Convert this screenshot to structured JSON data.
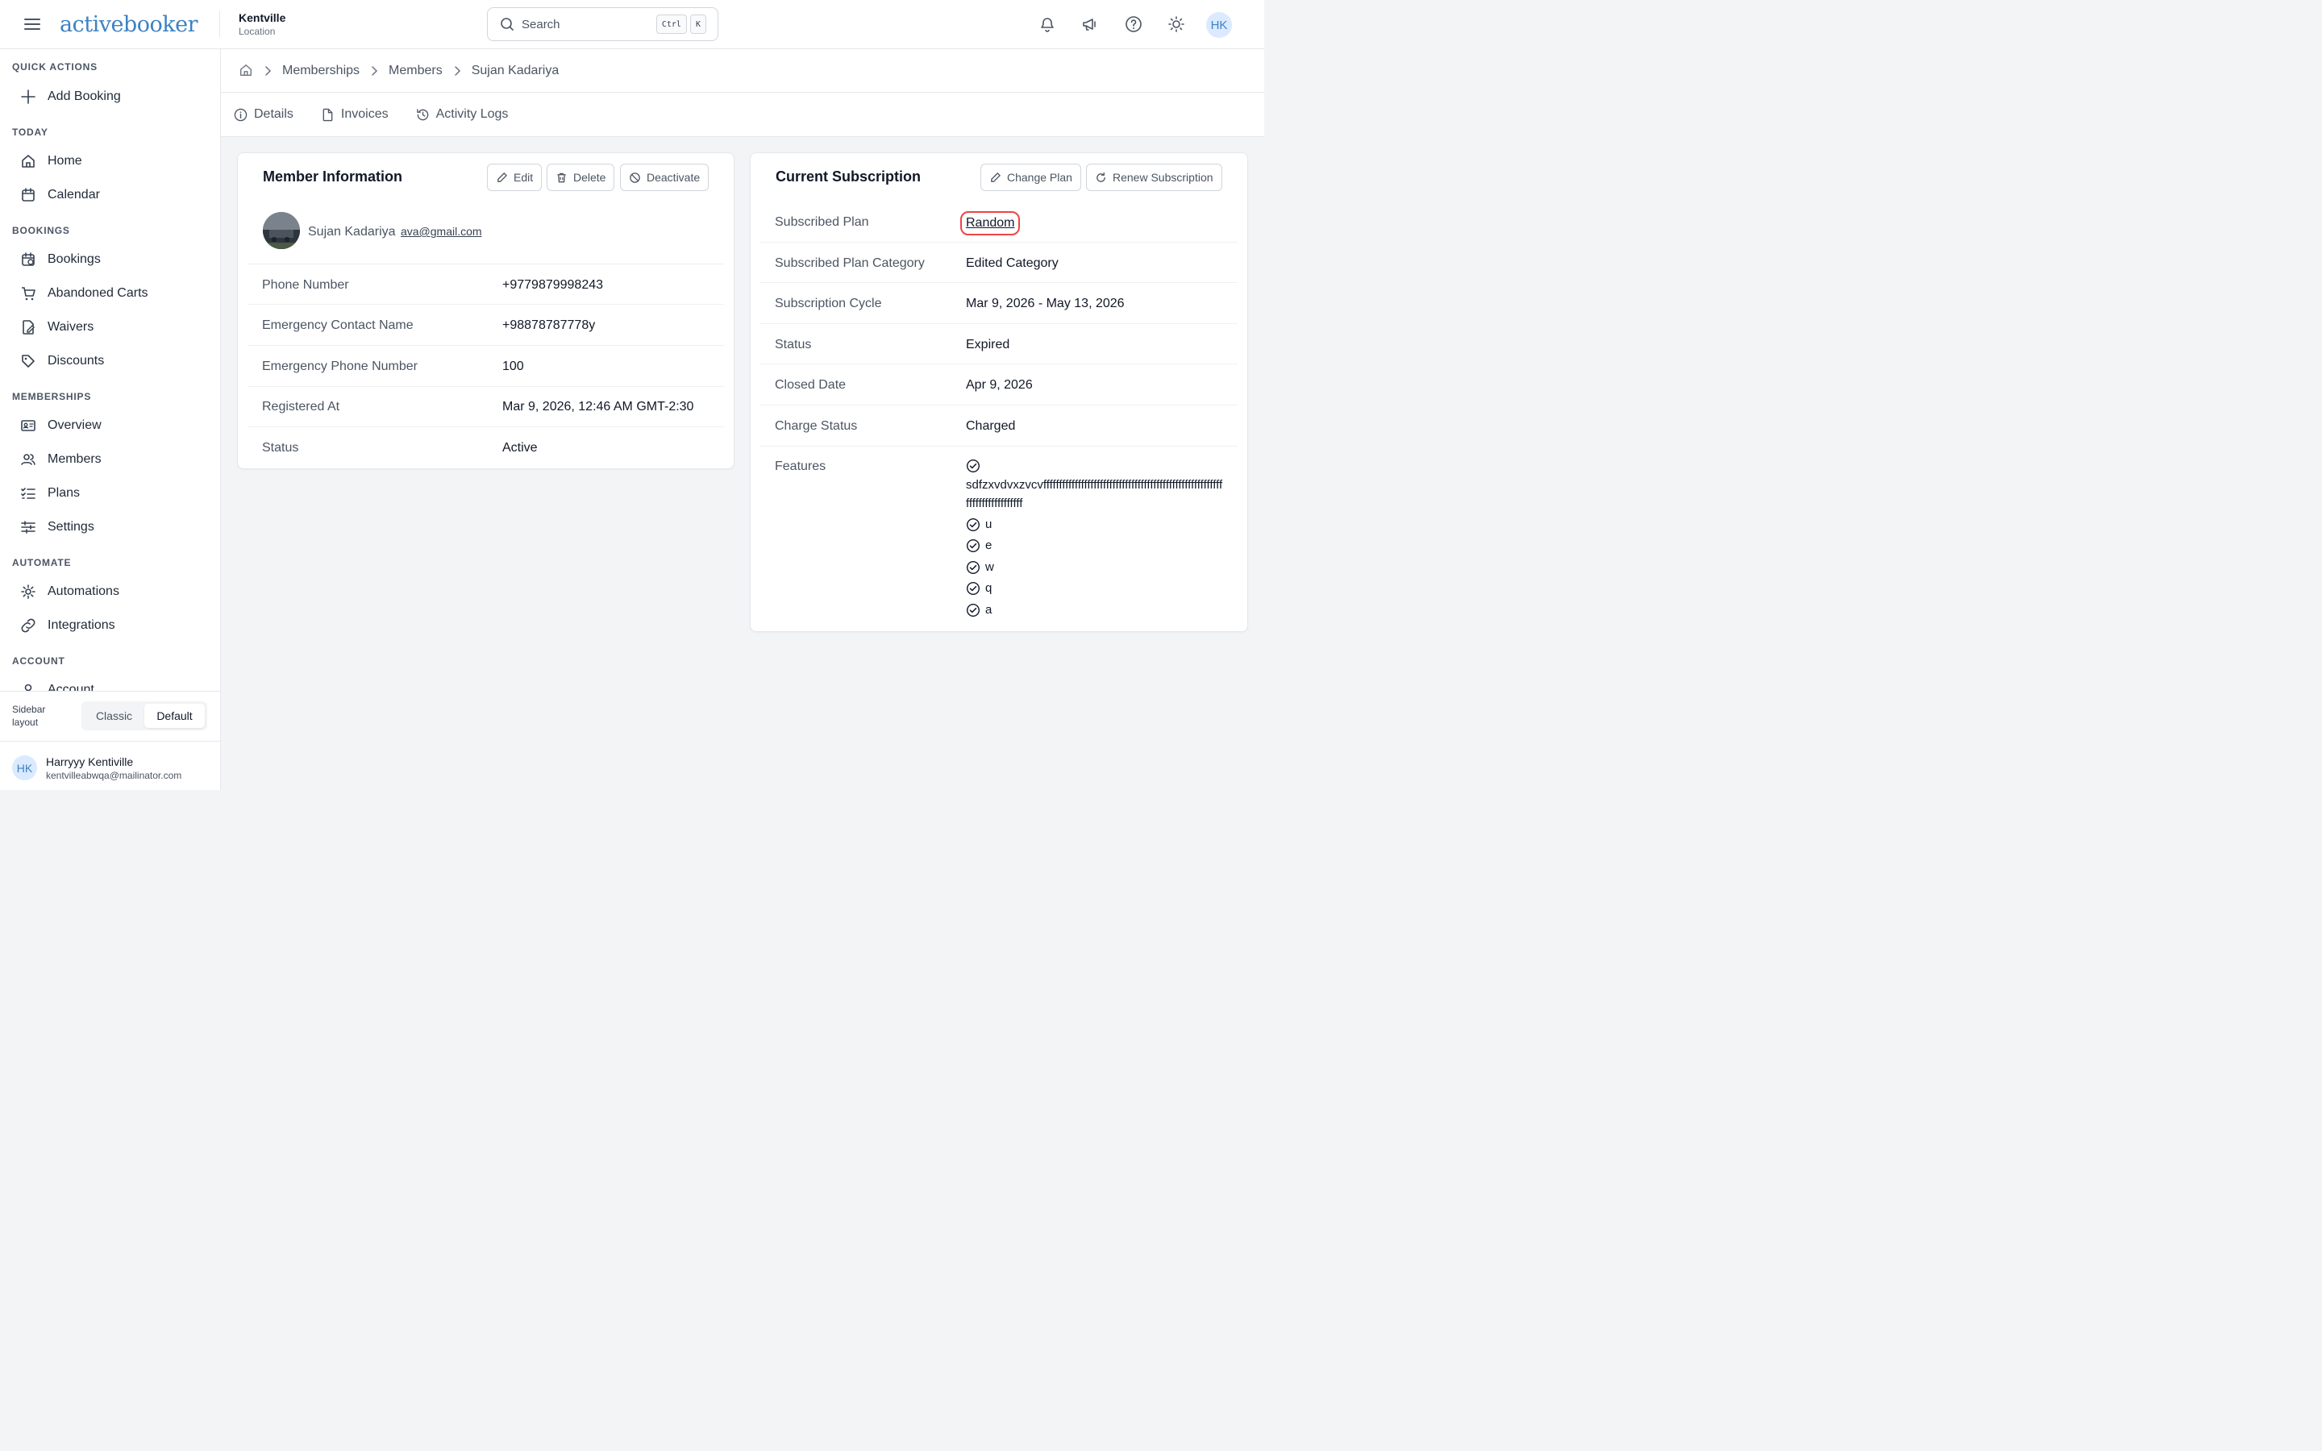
{
  "app": {
    "logo_text": "activebooker",
    "location_name": "Kentville",
    "location_label": "Location",
    "search_placeholder": "Search",
    "search_shortcut_1": "Ctrl",
    "search_shortcut_2": "K",
    "user_initials": "HK"
  },
  "sidebar": {
    "sections": [
      {
        "title": "QUICK ACTIONS",
        "items": [
          {
            "label": "Add Booking",
            "icon": "plus-icon"
          }
        ]
      },
      {
        "title": "TODAY",
        "items": [
          {
            "label": "Home",
            "icon": "home-icon"
          },
          {
            "label": "Calendar",
            "icon": "calendar-icon"
          }
        ]
      },
      {
        "title": "BOOKINGS",
        "items": [
          {
            "label": "Bookings",
            "icon": "calendar-clock-icon"
          },
          {
            "label": "Abandoned Carts",
            "icon": "cart-icon"
          },
          {
            "label": "Waivers",
            "icon": "file-signature-icon"
          },
          {
            "label": "Discounts",
            "icon": "tag-icon"
          }
        ]
      },
      {
        "title": "MEMBERSHIPS",
        "items": [
          {
            "label": "Overview",
            "icon": "id-card-icon"
          },
          {
            "label": "Members",
            "icon": "users-icon"
          },
          {
            "label": "Plans",
            "icon": "list-checks-icon"
          },
          {
            "label": "Settings",
            "icon": "sliders-icon"
          }
        ]
      },
      {
        "title": "AUTOMATE",
        "items": [
          {
            "label": "Automations",
            "icon": "gear-icon"
          },
          {
            "label": "Integrations",
            "icon": "link-icon"
          }
        ]
      },
      {
        "title": "ACCOUNT",
        "items": [
          {
            "label": "Account",
            "icon": "user-icon"
          }
        ]
      }
    ],
    "layout_label": "Sidebar layout",
    "layout_options": [
      "Classic",
      "Default"
    ],
    "layout_selected": "Default",
    "user": {
      "initials": "HK",
      "name": "Harryyy Kentiville",
      "email": "kentvilleabwqa@mailinator.com"
    }
  },
  "breadcrumb": [
    "Memberships",
    "Members",
    "Sujan Kadariya"
  ],
  "tabs": [
    {
      "label": "Details",
      "icon": "info-icon"
    },
    {
      "label": "Invoices",
      "icon": "file-icon"
    },
    {
      "label": "Activity Logs",
      "icon": "history-icon"
    }
  ],
  "member_card": {
    "title": "Member Information",
    "buttons": {
      "edit": "Edit",
      "delete": "Delete",
      "deactivate": "Deactivate"
    },
    "name": "Sujan Kadariya",
    "email": "ava@gmail.com",
    "fields": [
      {
        "label": "Phone Number",
        "value": "+9779879998243"
      },
      {
        "label": "Emergency Contact Name",
        "value": "+98878787778y"
      },
      {
        "label": "Emergency Phone Number",
        "value": "100"
      },
      {
        "label": "Registered At",
        "value": "Mar 9, 2026, 12:46 AM GMT-2:30"
      },
      {
        "label": "Status",
        "value": "Active"
      }
    ]
  },
  "subscription_card": {
    "title": "Current Subscription",
    "buttons": {
      "change_plan": "Change Plan",
      "renew": "Renew Subscription"
    },
    "plan_label": "Subscribed Plan",
    "plan_value": "Random",
    "fields": [
      {
        "label": "Subscribed Plan Category",
        "value": "Edited Category"
      },
      {
        "label": "Subscription Cycle",
        "value": "Mar 9, 2026 - May 13, 2026"
      },
      {
        "label": "Status",
        "value": "Expired"
      },
      {
        "label": "Closed Date",
        "value": "Apr 9, 2026"
      },
      {
        "label": "Charge Status",
        "value": "Charged"
      }
    ],
    "features_label": "Features",
    "features": [
      "sdfzxvdvxzvcvfffffffffffffffffffffffffffffffffffffffffffffffffffffffffffffffffffffffffff",
      "u",
      "e",
      "w",
      "q",
      "a"
    ]
  },
  "colors": {
    "brand": "#3b82c4",
    "highlight": "#ef4444"
  }
}
